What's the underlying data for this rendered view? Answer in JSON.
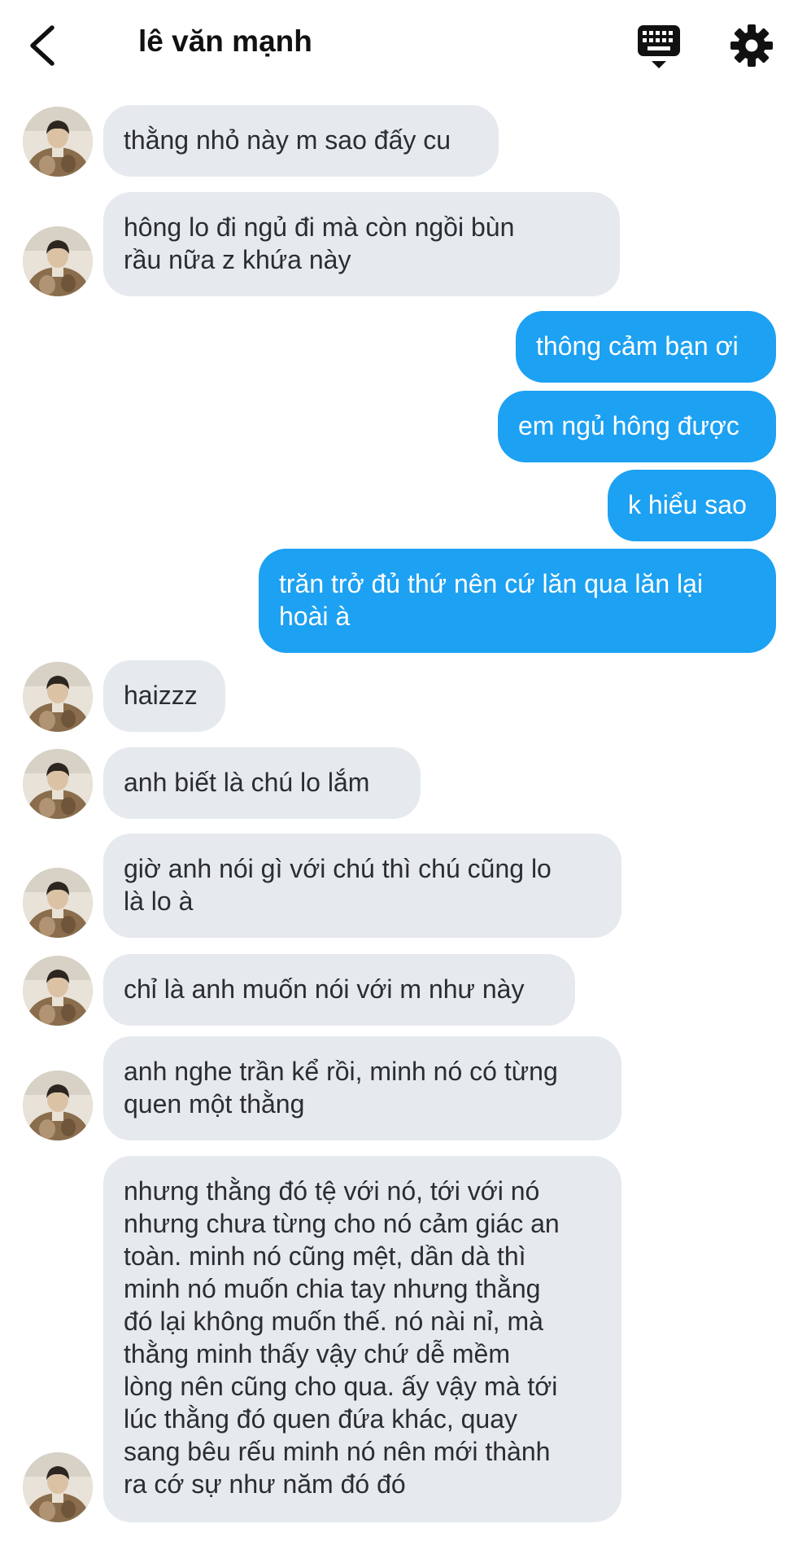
{
  "header": {
    "title": "lê văn mạnh",
    "icons": {
      "back": "chevron-left-icon",
      "keyboard": "keyboard-icon",
      "settings": "gear-icon"
    }
  },
  "colors": {
    "incoming_bubble": "#e6e9ee",
    "outgoing_bubble": "#1da1f2",
    "background": "#ffffff"
  },
  "messages": [
    {
      "from": "them",
      "text": "thằng nhỏ này m sao đấy cu"
    },
    {
      "from": "them",
      "text": "hông lo đi ngủ đi mà còn ngồi bùn\nrầu nữa z khứa này"
    },
    {
      "from": "me",
      "text": "thông cảm bạn ơi"
    },
    {
      "from": "me",
      "text": "em ngủ hông được"
    },
    {
      "from": "me",
      "text": "k hiểu sao"
    },
    {
      "from": "me",
      "text": "trăn trở đủ thứ nên cứ lăn qua lăn lại\nhoài à"
    },
    {
      "from": "them",
      "text": "haizzz"
    },
    {
      "from": "them",
      "text": "anh biết là chú lo lắm"
    },
    {
      "from": "them",
      "text": "giờ anh nói gì với chú thì chú cũng lo\nlà lo à"
    },
    {
      "from": "them",
      "text": "chỉ là anh muốn nói với m như này"
    },
    {
      "from": "them",
      "text": "anh nghe trần kể rồi, minh nó có từng\nquen một thằng"
    },
    {
      "from": "them",
      "text": "nhưng thằng đó tệ với nó, tới với nó\nnhưng chưa từng cho nó cảm giác an\ntoàn. minh nó cũng mệt, dần dà thì\nminh nó muốn chia tay nhưng thằng\nđó lại không muốn thế. nó nài nỉ, mà\nthằng minh thấy vậy chứ dễ mềm\nlòng nên cũng cho qua. ấy vậy mà tới\nlúc thằng đó quen đứa khác, quay\nsang bêu rếu minh nó nên mới thành\nra cớ sự như năm đó đó"
    }
  ]
}
